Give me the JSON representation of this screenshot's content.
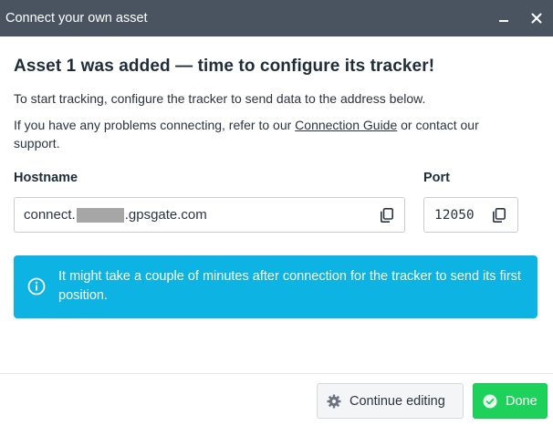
{
  "window": {
    "title": "Connect your own asset",
    "minimize_icon": "minimize-icon",
    "close_icon": "close-icon"
  },
  "main": {
    "heading": "Asset 1 was added — time to configure its tracker!",
    "intro": "To start tracking, configure the tracker to send data to the address below.",
    "help_prefix": "If you have any problems connecting, refer to our ",
    "help_link": "Connection Guide",
    "help_suffix": " or contact our support."
  },
  "hostname": {
    "label": "Hostname",
    "value_prefix": "connect.",
    "value_suffix": ".gpsgate.com",
    "copy_icon": "copy-icon"
  },
  "port": {
    "label": "Port",
    "value": "12050",
    "copy_icon": "copy-icon"
  },
  "info": {
    "icon": "info-icon",
    "text": "It might take a couple of minutes after connection for the tracker to send its first position.",
    "color": "#0db3e3"
  },
  "footer": {
    "continue_label": "Continue editing",
    "continue_icon": "gear-icon",
    "done_label": "Done",
    "done_icon": "check-circle-icon",
    "done_color": "#1ed15a"
  },
  "colors": {
    "titlebar": "#4a5461",
    "text": "#1f2d3a"
  }
}
